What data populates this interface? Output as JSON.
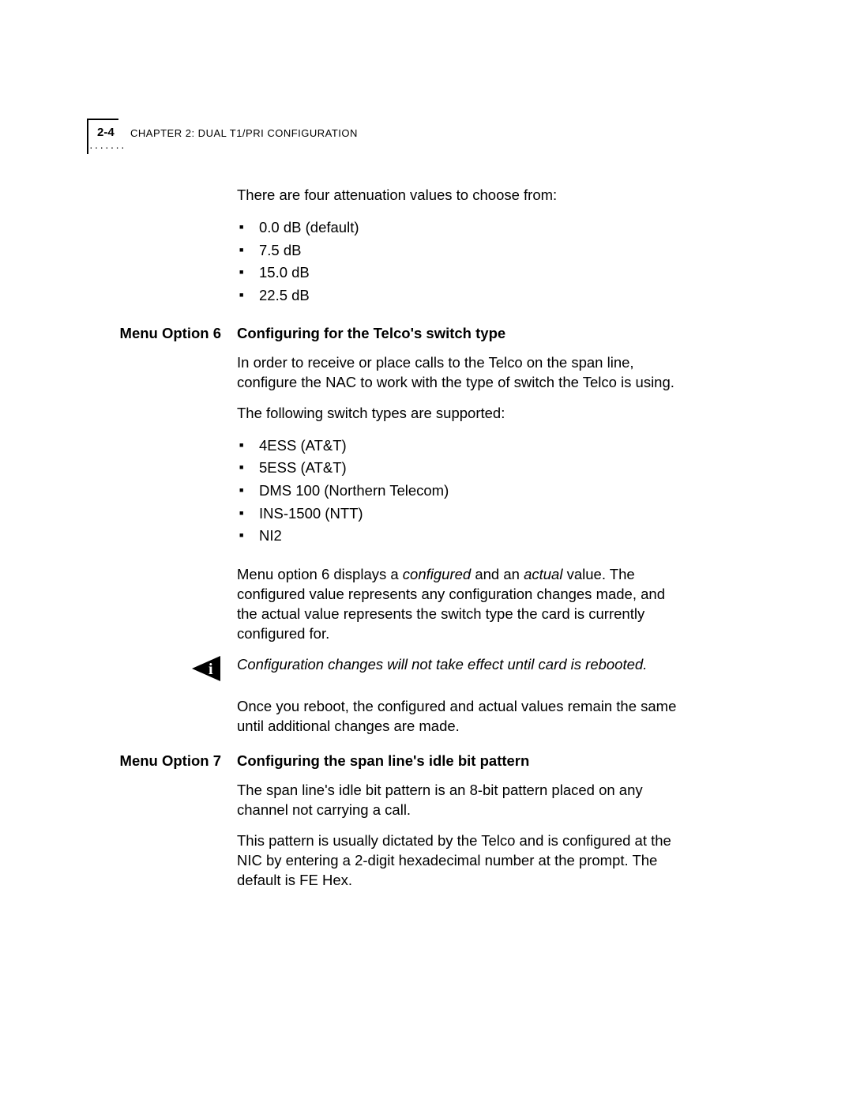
{
  "header": {
    "page_number": "2-4",
    "chapter": "CHAPTER 2: DUAL T1/PRI CONFIGURATION"
  },
  "intro": {
    "lead": "There are four attenuation values to choose from:",
    "items": [
      "0.0 dB (default)",
      "7.5 dB",
      "15.0 dB",
      "22.5 dB"
    ]
  },
  "option6": {
    "label": "Menu Option 6",
    "title": "Configuring for the Telco's switch type",
    "para1": "In order to receive or place calls to the Telco on the span line, configure the NAC to work with the type of switch the Telco is using.",
    "para2": "The following switch types are supported:",
    "items": [
      "4ESS (AT&T)",
      "5ESS (AT&T)",
      "DMS 100 (Northern Telecom)",
      "INS-1500 (NTT)",
      "NI2"
    ],
    "para3_pre": "Menu option 6 displays a ",
    "para3_em1": "configured",
    "para3_mid": " and an ",
    "para3_em2": "actual",
    "para3_post": " value. The configured value represents any configuration changes made, and the actual value represents the switch type the card is currently configured for.",
    "note": "Configuration changes will not take effect until card is rebooted.",
    "para4": "Once you reboot, the configured and actual values remain the same until additional changes are made."
  },
  "option7": {
    "label": "Menu Option 7",
    "title": "Configuring the span line's idle bit pattern",
    "para1": "The span line's idle bit pattern is an 8-bit pattern placed on any channel not carrying a call.",
    "para2": "This pattern is usually dictated by the Telco and is configured at the NIC by entering a 2-digit hexadecimal number at the prompt. The default is FE Hex."
  }
}
